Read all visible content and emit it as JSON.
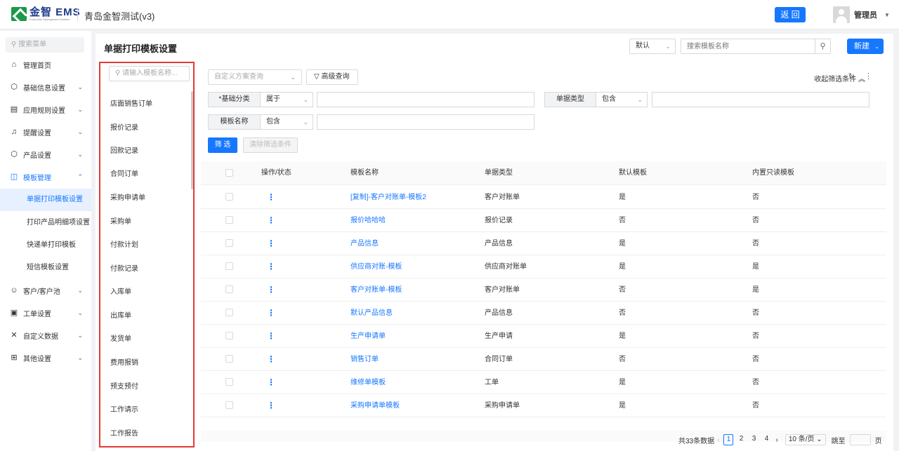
{
  "header": {
    "logo_text": "金智 EMS",
    "logo_sub": "Enterprise Management System",
    "project": "青岛金智测试(v3)",
    "back_label": "返 回",
    "user_name": "管理员"
  },
  "sidebar": {
    "search_placeholder": "搜索菜单",
    "items": [
      {
        "label": "管理首页",
        "icon": "home-icon"
      },
      {
        "label": "基础信息设置",
        "icon": "cube-icon"
      },
      {
        "label": "应用规则设置",
        "icon": "document-icon"
      },
      {
        "label": "提醒设置",
        "icon": "bell-icon"
      },
      {
        "label": "产品设置",
        "icon": "cube-icon"
      },
      {
        "label": "模板管理",
        "icon": "template-icon"
      },
      {
        "label": "客户/客户池",
        "icon": "users-icon"
      },
      {
        "label": "工单设置",
        "icon": "ticket-icon"
      },
      {
        "label": "自定义数据",
        "icon": "tools-icon"
      },
      {
        "label": "其他设置",
        "icon": "grid-icon"
      }
    ],
    "sub_items": [
      "单据打印模板设置",
      "打印产品明细项设置",
      "快递单打印模板",
      "短信模板设置"
    ]
  },
  "main": {
    "title": "单据打印模板设置",
    "default_select": "默认",
    "search_placeholder": "搜索模板名称",
    "new_label": "新建"
  },
  "template_list": {
    "search_placeholder": "请输入模板名称...",
    "items": [
      "店面销售订单",
      "报价记录",
      "回款记录",
      "合同订单",
      "采购申请单",
      "采购单",
      "付款计划",
      "付款记录",
      "入库单",
      "出库单",
      "发货单",
      "费用报销",
      "预支预付",
      "工作请示",
      "工作报告"
    ]
  },
  "filters": {
    "custom_placeholder": "自定义方案查询",
    "advanced_label": "高级查询",
    "collapse_label": "收起筛选条件",
    "category_label": "*基础分类",
    "category_op": "属于",
    "doctype_label": "单据类型",
    "doctype_op": "包含",
    "name_label": "模板名称",
    "name_op": "包含",
    "filter_btn": "筛 选",
    "clear_btn": "清除筛选条件"
  },
  "table": {
    "headers": [
      "操作/状态",
      "模板名称",
      "单据类型",
      "默认模板",
      "内置只读模板"
    ],
    "rows": [
      [
        "[复制]-客户对账单-模板2",
        "客户对账单",
        "是",
        "否"
      ],
      [
        "报价哈哈哈",
        "报价记录",
        "否",
        "否"
      ],
      [
        "产品信息",
        "产品信息",
        "是",
        "否"
      ],
      [
        "供应商对账-模板",
        "供应商对账单",
        "是",
        "是"
      ],
      [
        "客户对账单-模板",
        "客户对账单",
        "否",
        "是"
      ],
      [
        "默认产品信息",
        "产品信息",
        "否",
        "否"
      ],
      [
        "生产申请单",
        "生产申请",
        "是",
        "否"
      ],
      [
        "销售订单",
        "合同订单",
        "否",
        "否"
      ],
      [
        "维修单模板",
        "工单",
        "是",
        "否"
      ],
      [
        "采购申请单模板",
        "采购申请单",
        "是",
        "否"
      ]
    ]
  },
  "pagination": {
    "total": "共33条数据",
    "pages": [
      "1",
      "2",
      "3",
      "4"
    ],
    "page_size": "10 条/页",
    "jump_label": "跳至",
    "page_unit": "页"
  }
}
